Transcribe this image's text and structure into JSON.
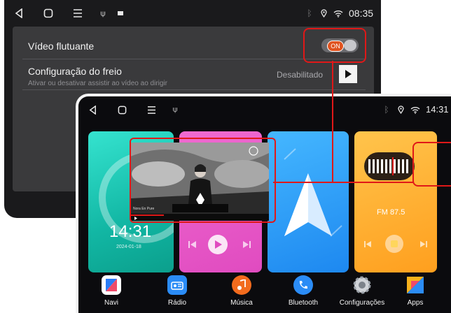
{
  "back_screen": {
    "status": {
      "time": "08:35"
    },
    "settings": {
      "floating_video": {
        "label": "Vídeo flutuante",
        "toggle": "ON"
      },
      "brake": {
        "label": "Configuração do freio",
        "description": "Ativar ou desativar assistir ao vídeo ao dirigir",
        "value": "Desabilitado"
      }
    }
  },
  "front_screen": {
    "status": {
      "time": "14:31"
    },
    "clock_card": {
      "time": "14:31",
      "date": "2024-01-18"
    },
    "video": {
      "caption": "Nora En Pure"
    },
    "radio_card": {
      "frequency": "FM 87.5"
    },
    "dock": [
      {
        "label": "Navi",
        "icon": "navi-icon"
      },
      {
        "label": "Rádio",
        "icon": "radio-icon"
      },
      {
        "label": "Música",
        "icon": "music-icon"
      },
      {
        "label": "Bluetooth",
        "icon": "phone-icon"
      },
      {
        "label": "Configurações",
        "icon": "settings-icon"
      },
      {
        "label": "Apps",
        "icon": "apps-icon"
      }
    ]
  },
  "colors": {
    "highlight": "#e01818",
    "toggle_on": "#e0531f"
  }
}
